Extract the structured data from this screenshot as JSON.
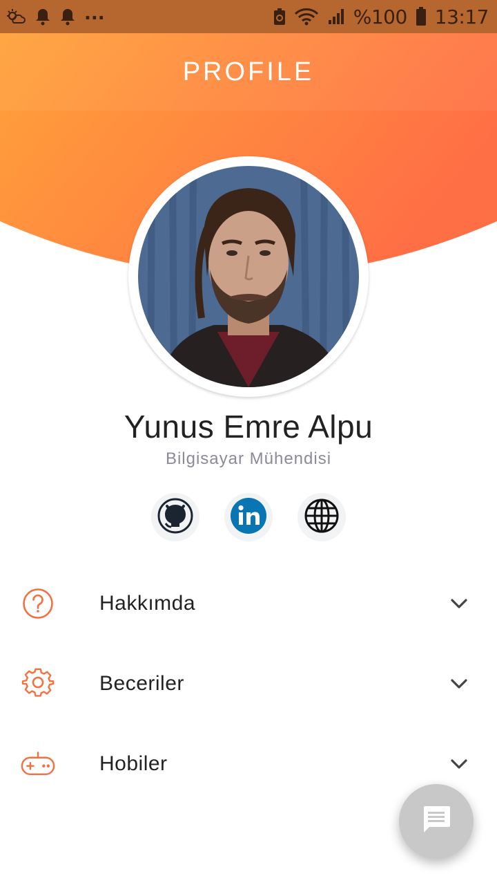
{
  "statusbar": {
    "battery_text": "%100",
    "time": "13:17",
    "overflow": "...",
    "icons": [
      "weather-icon",
      "notification-bell-icon",
      "notification-bell-icon",
      "battery-saver-icon",
      "wifi-icon",
      "signal-icon",
      "battery-icon"
    ]
  },
  "header": {
    "title": "PROFILE",
    "gradient_start": "#ffa23a",
    "gradient_end": "#ff6f45"
  },
  "profile": {
    "name": "Yunus Emre Alpu",
    "subtitle": "Bilgisayar Mühendisi"
  },
  "social": [
    {
      "name": "github",
      "icon": "github-icon"
    },
    {
      "name": "linkedin",
      "icon": "linkedin-icon",
      "color": "#0a75b3"
    },
    {
      "name": "website",
      "icon": "globe-icon"
    }
  ],
  "menu": {
    "items": [
      {
        "label": "Hakkımda",
        "icon": "question-circle-icon"
      },
      {
        "label": "Beceriler",
        "icon": "gear-icon"
      },
      {
        "label": "Hobiler",
        "icon": "gamepad-icon"
      }
    ],
    "accent": "#f4703f"
  },
  "fab": {
    "icon": "chat-message-icon"
  }
}
